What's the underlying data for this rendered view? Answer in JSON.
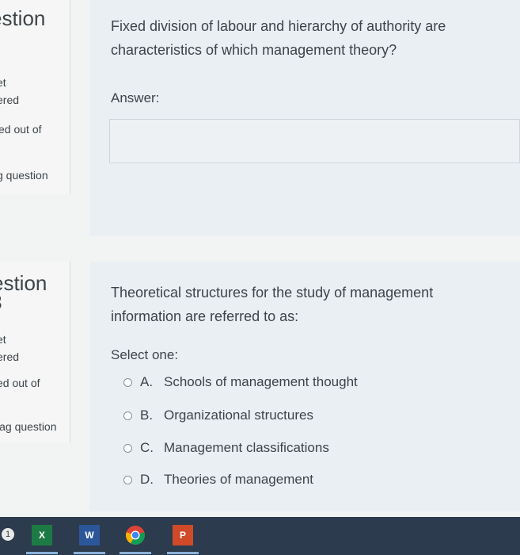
{
  "question1": {
    "info": {
      "title": "estion",
      "status_partial": "et",
      "answered": "ered",
      "marked": "ed out of",
      "flag": "g question"
    },
    "text": "Fixed division of labour and hierarchy of authority are characteristics of which management theory?",
    "answer_label": "Answer:",
    "answer_value": ""
  },
  "question2": {
    "info": {
      "title": "estion",
      "number": "3",
      "status_partial": "et",
      "answered": "ered",
      "marked": "ed out of",
      "flag": "lag question"
    },
    "text": "Theoretical structures for the study of management information are referred to as:",
    "select_label": "Select one:",
    "options": [
      {
        "letter": "A.",
        "text": "Schools of management thought"
      },
      {
        "letter": "B.",
        "text": "Organizational structures"
      },
      {
        "letter": "C.",
        "text": "Management classifications"
      },
      {
        "letter": "D.",
        "text": "Theories of management"
      }
    ]
  },
  "taskbar": {
    "notification_count": "1",
    "apps": [
      {
        "name": "excel-icon",
        "glyph": "X",
        "color": "#1e7a45"
      },
      {
        "name": "word-icon",
        "glyph": "W",
        "color": "#2b579a"
      },
      {
        "name": "chrome-icon",
        "glyph": "",
        "color": "#f4b400"
      },
      {
        "name": "powerpoint-icon",
        "glyph": "P",
        "color": "#d04a2a"
      }
    ]
  }
}
